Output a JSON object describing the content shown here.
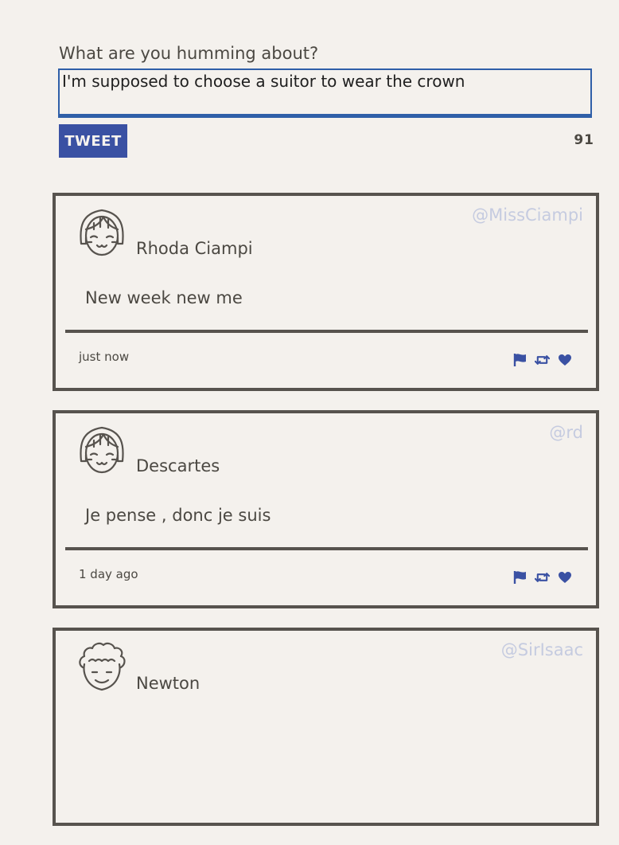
{
  "compose": {
    "label": "What are you humming about?",
    "input_value": "I'm supposed to choose a suitor to wear the crown",
    "tweet_button_label": "TWEET",
    "char_count": "91"
  },
  "colors": {
    "accent": "#3a51a3",
    "border": "#57534e",
    "text": "#4b4842",
    "username": "#c5cbe0",
    "background": "#f4f1ed",
    "input_border": "#2f5fa8"
  },
  "tweets": [
    {
      "username": "@MissCiampi",
      "display_name": "Rhoda Ciampi",
      "text": "New week new me",
      "timestamp": "just now",
      "avatar": "girl-avatar-icon"
    },
    {
      "username": "@rd",
      "display_name": "Descartes",
      "text": "Je pense , donc je suis",
      "timestamp": "1 day ago",
      "avatar": "girl-avatar-icon"
    },
    {
      "username": "@SirIsaac",
      "display_name": "Newton",
      "text": "",
      "timestamp": "",
      "avatar": "curly-hair-avatar-icon"
    }
  ]
}
